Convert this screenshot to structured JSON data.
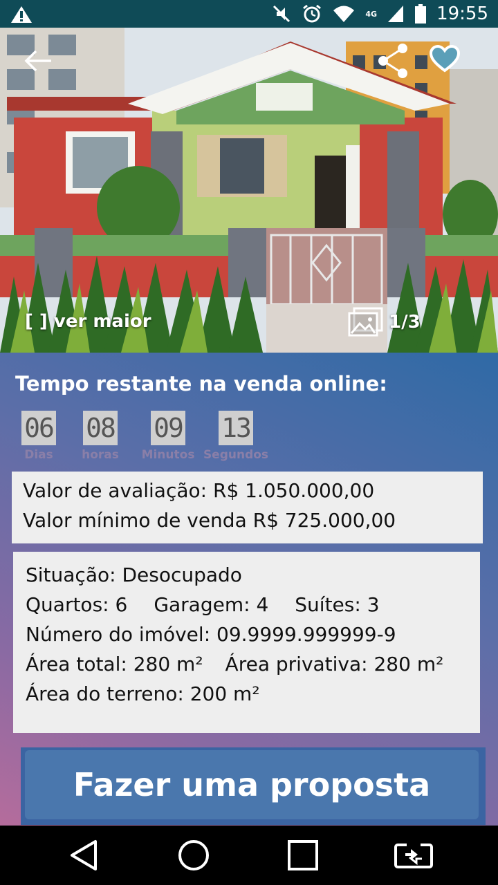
{
  "status_bar": {
    "time": "19:55",
    "network": "4G",
    "icons": [
      "warning-icon",
      "mute-icon",
      "alarm-icon",
      "wifi-icon",
      "signal-icon",
      "battery-icon"
    ]
  },
  "hero": {
    "expand_label": "[ ] ver maior",
    "photo_counter": "1/3",
    "icons": [
      "back-arrow-icon",
      "share-icon",
      "heart-icon",
      "gallery-icon"
    ]
  },
  "countdown": {
    "heading": "Tempo restante na venda online:",
    "units": [
      {
        "value": "06",
        "label": "Dias"
      },
      {
        "value": "08",
        "label": "horas"
      },
      {
        "value": "09",
        "label": "Minutos"
      },
      {
        "value": "13",
        "label": "Segundos"
      }
    ]
  },
  "prices": {
    "appraisal": "Valor de avaliação: R$ 1.050.000,00",
    "minimum": "Valor mínimo de venda R$ 725.000,00"
  },
  "details": {
    "situation": "Situação: Desocupado",
    "rooms": "Quartos: 6",
    "garage": "Garagem: 4",
    "suites": "Suítes: 3",
    "property_number": "Número do imóvel: 09.9999.999999-9",
    "total_area": "Área total: 280 m²",
    "private_area": "Área privativa: 280 m²",
    "land_area": "Área do terreno: 200 m²"
  },
  "cta": {
    "label": "Fazer uma proposta"
  },
  "colors": {
    "status_bar": "#0f4b57",
    "gradient_top": "#2f6aa6",
    "gradient_bottom": "#b56c9c",
    "button": "#4a77ad"
  }
}
